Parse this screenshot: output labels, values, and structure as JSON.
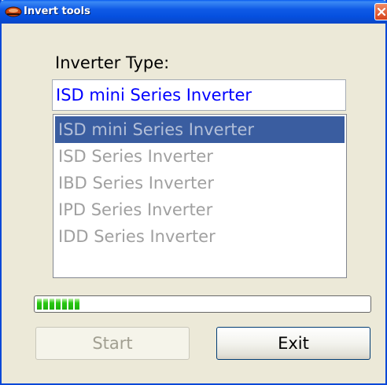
{
  "window": {
    "title": "Invert tools",
    "close_icon": "close-x-icon",
    "app_icon": "app-icon"
  },
  "form": {
    "type_label": "Inverter Type:",
    "type_value": "ISD mini Series Inverter"
  },
  "list": {
    "items": [
      "ISD mini Series Inverter",
      "ISD Series Inverter",
      "IBD Series Inverter",
      "IPD Series Inverter",
      "IDD Series Inverter"
    ],
    "selected": "ISD mini Series Inverter"
  },
  "progress": {
    "value": 0.13,
    "color": "#28c811"
  },
  "buttons": {
    "start_label": "Start",
    "exit_label": "Exit"
  },
  "colors": {
    "titlebar": "#0a5cf0",
    "selection": "#3a5da0",
    "input_text": "#0000ff",
    "close": "#d5431c"
  }
}
